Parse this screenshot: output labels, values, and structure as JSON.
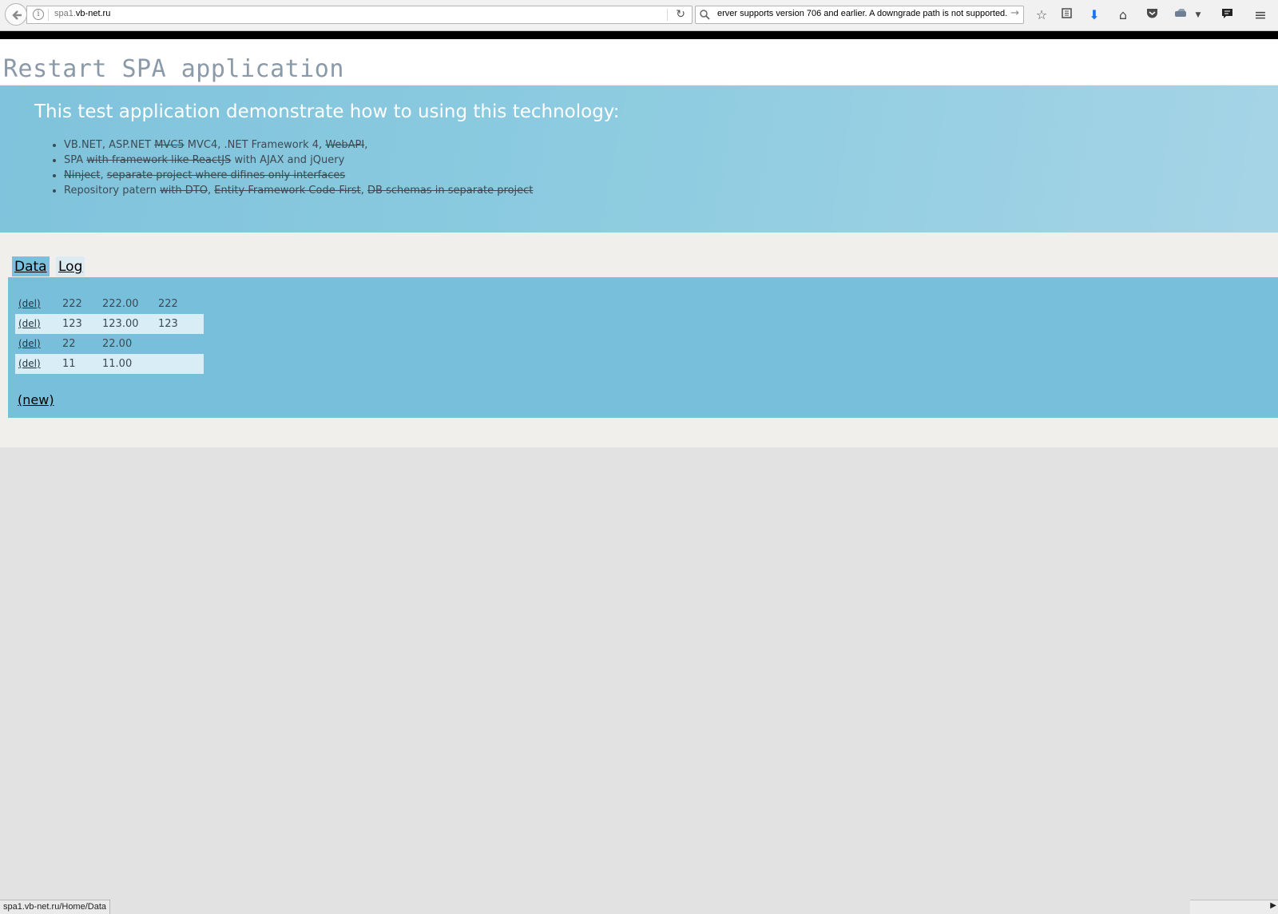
{
  "browser": {
    "url_host": "spa1.",
    "url_rest": "vb-net.ru",
    "search_text": "erver supports version 706 and earlier. A downgrade path is not supported."
  },
  "page": {
    "title": "Restart SPA application",
    "hero": {
      "heading": "This test application demonstrate how to using this technology:",
      "items": [
        [
          {
            "text": "VB.NET, ASP.NET ",
            "strike": false
          },
          {
            "text": "MVC5",
            "strike": true
          },
          {
            "text": " MVC4, .NET Framework 4, ",
            "strike": false
          },
          {
            "text": "WebAPI",
            "strike": true
          },
          {
            "text": ",",
            "strike": false
          }
        ],
        [
          {
            "text": "SPA ",
            "strike": false
          },
          {
            "text": "with framework like ReactJS",
            "strike": true
          },
          {
            "text": " with AJAX and jQuery",
            "strike": false
          }
        ],
        [
          {
            "text": "Ninject",
            "strike": true
          },
          {
            "text": ", ",
            "strike": false
          },
          {
            "text": "separate project where difines only interfaces",
            "strike": true
          }
        ],
        [
          {
            "text": "Repository patern ",
            "strike": false
          },
          {
            "text": "with DTO",
            "strike": true
          },
          {
            "text": ", ",
            "strike": false
          },
          {
            "text": "Entity Framework Code-First",
            "strike": true
          },
          {
            "text": ", ",
            "strike": false
          },
          {
            "text": "DB schemas in separate project",
            "strike": true
          }
        ]
      ]
    },
    "tabs": {
      "data": "Data",
      "log": "Log"
    },
    "table": {
      "delete_label": "(del)",
      "rows": [
        [
          "222",
          "222.00",
          "222"
        ],
        [
          "123",
          "123.00",
          "123"
        ],
        [
          "22",
          "22.00",
          ""
        ],
        [
          "11",
          "11.00",
          ""
        ]
      ]
    },
    "new_label": "(new)"
  },
  "status": {
    "text": "spa1.vb-net.ru/Home/Data"
  }
}
